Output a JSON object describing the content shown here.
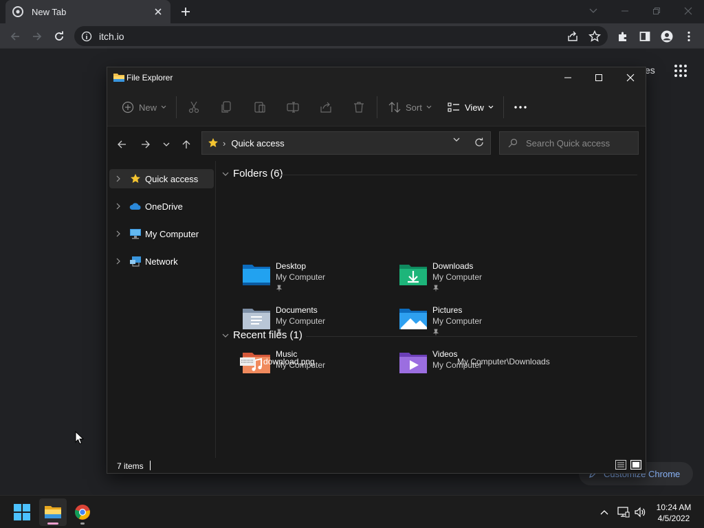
{
  "chrome": {
    "tab_title": "New Tab",
    "url": "itch.io",
    "ntp_partial_link": "es",
    "customize_label": "Customize Chrome"
  },
  "explorer": {
    "title": "File Explorer",
    "command_bar": {
      "new_label": "New",
      "sort_label": "Sort",
      "view_label": "View"
    },
    "address": {
      "location": "Quick access",
      "search_placeholder": "Search Quick access"
    },
    "sidebar": {
      "items": [
        {
          "label": "Quick access",
          "icon": "star-icon"
        },
        {
          "label": "OneDrive",
          "icon": "cloud-icon"
        },
        {
          "label": "My Computer",
          "icon": "computer-icon"
        },
        {
          "label": "Network",
          "icon": "network-icon"
        }
      ]
    },
    "folders_header": "Folders (6)",
    "folders": [
      {
        "name": "Desktop",
        "location": "My Computer",
        "pinned": true
      },
      {
        "name": "Downloads",
        "location": "My Computer",
        "pinned": true
      },
      {
        "name": "Documents",
        "location": "My Computer",
        "pinned": true
      },
      {
        "name": "Pictures",
        "location": "My Computer",
        "pinned": true
      },
      {
        "name": "Music",
        "location": "My Computer",
        "pinned": false
      },
      {
        "name": "Videos",
        "location": "My Computer",
        "pinned": false
      }
    ],
    "recent_header": "Recent files (1)",
    "recent_files": [
      {
        "name": "download.png",
        "path": "My Computer\\Downloads"
      }
    ],
    "status": {
      "item_count": "7 items"
    }
  },
  "taskbar": {
    "time": "10:24 AM",
    "date": "4/5/2022"
  },
  "colors": {
    "accent_blue": "#0078d4",
    "folder_yellow": "#f2c14e",
    "link_blue": "#8ab4f8"
  }
}
